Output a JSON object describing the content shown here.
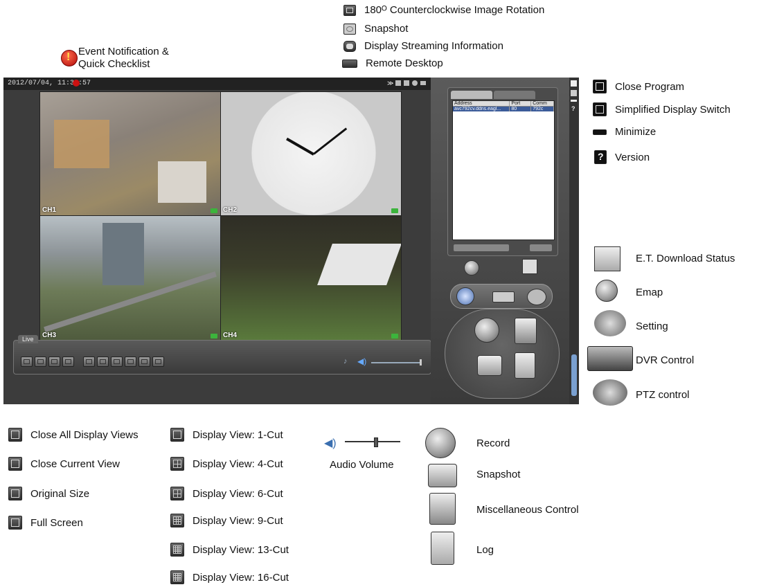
{
  "colors": {
    "window_bg": "#3c3c3c",
    "panel_bg": "#4a4a4a",
    "alert_red": "#cc1111",
    "rec_green": "#3cb43c",
    "selection_blue": "#3b5b99"
  },
  "top_legend": [
    {
      "icon": "image-rotation-icon",
      "label": "180ᴼ Counterclockwise Image Rotation"
    },
    {
      "icon": "snapshot-small-icon",
      "label": "Snapshot"
    },
    {
      "icon": "streaming-info-icon",
      "label": "Display Streaming Information"
    },
    {
      "icon": "remote-desktop-icon",
      "label": "Remote Desktop"
    }
  ],
  "event_notification": {
    "line1": "Event Notification &",
    "line2": "Quick Checklist"
  },
  "window_legend": [
    {
      "icon": "close-program-icon",
      "label": "Close Program"
    },
    {
      "icon": "simplified-display-switch-icon",
      "label": "Simplified Display Switch"
    },
    {
      "icon": "minimize-icon",
      "label": "Minimize"
    },
    {
      "icon": "version-icon",
      "label": "Version"
    }
  ],
  "function_legend": [
    {
      "icon": "download-status-icon",
      "label": "E.T. Download Status"
    },
    {
      "icon": "emap-icon",
      "label": "Emap"
    },
    {
      "icon": "setting-icon",
      "label": "Setting"
    },
    {
      "icon": "dvr-control-icon",
      "label": "DVR Control"
    },
    {
      "icon": "ptz-control-icon",
      "label": "PTZ control"
    }
  ],
  "app": {
    "timestamp": "2012/07/04, 11:38:57",
    "channels": [
      "CH1",
      "CH2",
      "CH3",
      "CH4"
    ],
    "toolbar_tab": "Live",
    "address_table": {
      "headers": [
        "Address",
        "Port",
        "Comm"
      ],
      "rows": [
        [
          "avc792cv.ddns.eagl...",
          "80",
          "792c"
        ]
      ]
    }
  },
  "view_legend": [
    {
      "icon": "close-all-views-icon",
      "label": "Close All Display Views"
    },
    {
      "icon": "close-current-view-icon",
      "label": "Close Current View"
    },
    {
      "icon": "original-size-icon",
      "label": "Original Size"
    },
    {
      "icon": "full-screen-icon",
      "label": "Full Screen"
    }
  ],
  "cut_legend": [
    {
      "icon": "1-cut-icon",
      "label": "Display View: 1-Cut"
    },
    {
      "icon": "4-cut-icon",
      "label": "Display View: 4-Cut"
    },
    {
      "icon": "6-cut-icon",
      "label": "Display View: 6-Cut"
    },
    {
      "icon": "9-cut-icon",
      "label": "Display View: 9-Cut"
    },
    {
      "icon": "13-cut-icon",
      "label": "Display View: 13-Cut"
    },
    {
      "icon": "16-cut-icon",
      "label": "Display View: 16-Cut"
    }
  ],
  "audio": {
    "label": "Audio Volume",
    "volume_fraction": 0.55
  },
  "control_legend": [
    {
      "icon": "record-icon",
      "label": "Record"
    },
    {
      "icon": "snapshot-camera-icon",
      "label": "Snapshot"
    },
    {
      "icon": "misc-control-icon",
      "label": "Miscellaneous Control"
    },
    {
      "icon": "log-icon",
      "label": "Log"
    }
  ]
}
